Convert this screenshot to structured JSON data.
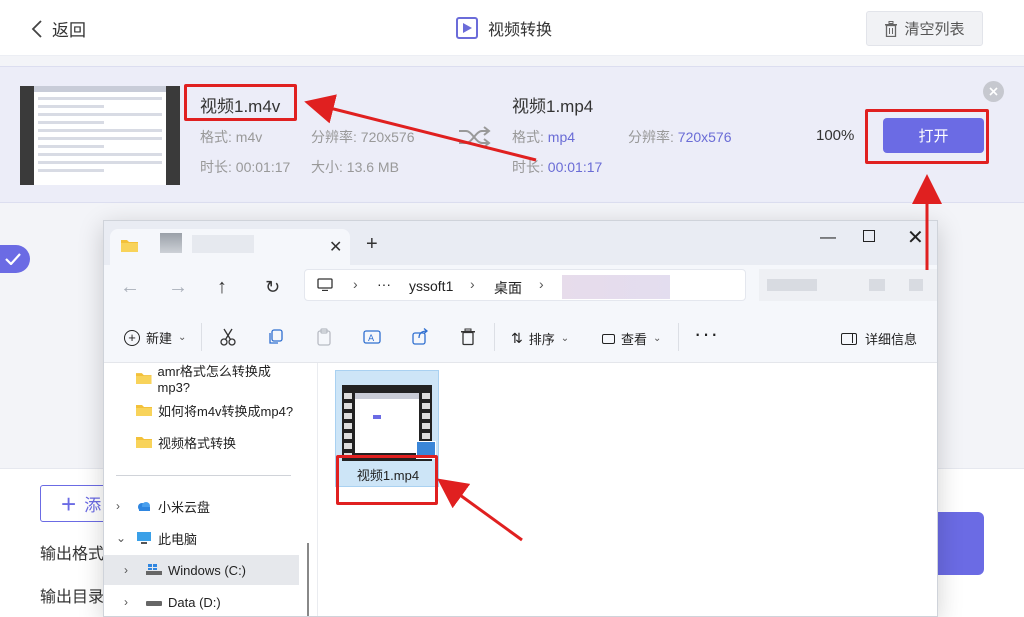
{
  "header": {
    "back_label": "返回",
    "title": "视频转换",
    "clear_label": "清空列表"
  },
  "task": {
    "source": {
      "name": "视频1.m4v",
      "format_label": "格式: ",
      "format": "m4v",
      "resolution_label": "分辨率: ",
      "resolution": "720x576",
      "duration_label": "时长: ",
      "duration": "00:01:17",
      "size_label": "大小: ",
      "size": "13.6 MB"
    },
    "output": {
      "name": "视频1.mp4",
      "format_label": "格式: ",
      "format": "mp4",
      "resolution_label": "分辨率: ",
      "resolution": "720x576",
      "duration_label": "时长: ",
      "duration": "00:01:17"
    },
    "progress_text": "100%",
    "open_label": "打开"
  },
  "bottom": {
    "add_label": "添",
    "output_format_label": "输出格式",
    "output_dir_label": "输出目录"
  },
  "explorer": {
    "new_tab_symbol": "+",
    "address": {
      "ellipsis": "···",
      "crumbs": [
        "yssoft1",
        "桌面"
      ]
    },
    "toolbar": {
      "new_label": "新建",
      "sort_label": "排序",
      "view_label": "查看",
      "more_label": "···",
      "details_label": "详细信息"
    },
    "sidebar": {
      "folders": [
        "amr格式怎么转换成mp3?",
        "如何将m4v转换成mp4?",
        "视频格式转换"
      ],
      "cloud": "小米云盘",
      "this_pc": "此电脑",
      "drive_c": "Windows (C:)",
      "drive_d": "Data (D:)"
    },
    "files": [
      {
        "name": "视频1.mp4"
      }
    ]
  },
  "colors": {
    "accent": "#6b6be4",
    "annotation_red": "#e02020",
    "card_bg": "#ecedf8"
  }
}
